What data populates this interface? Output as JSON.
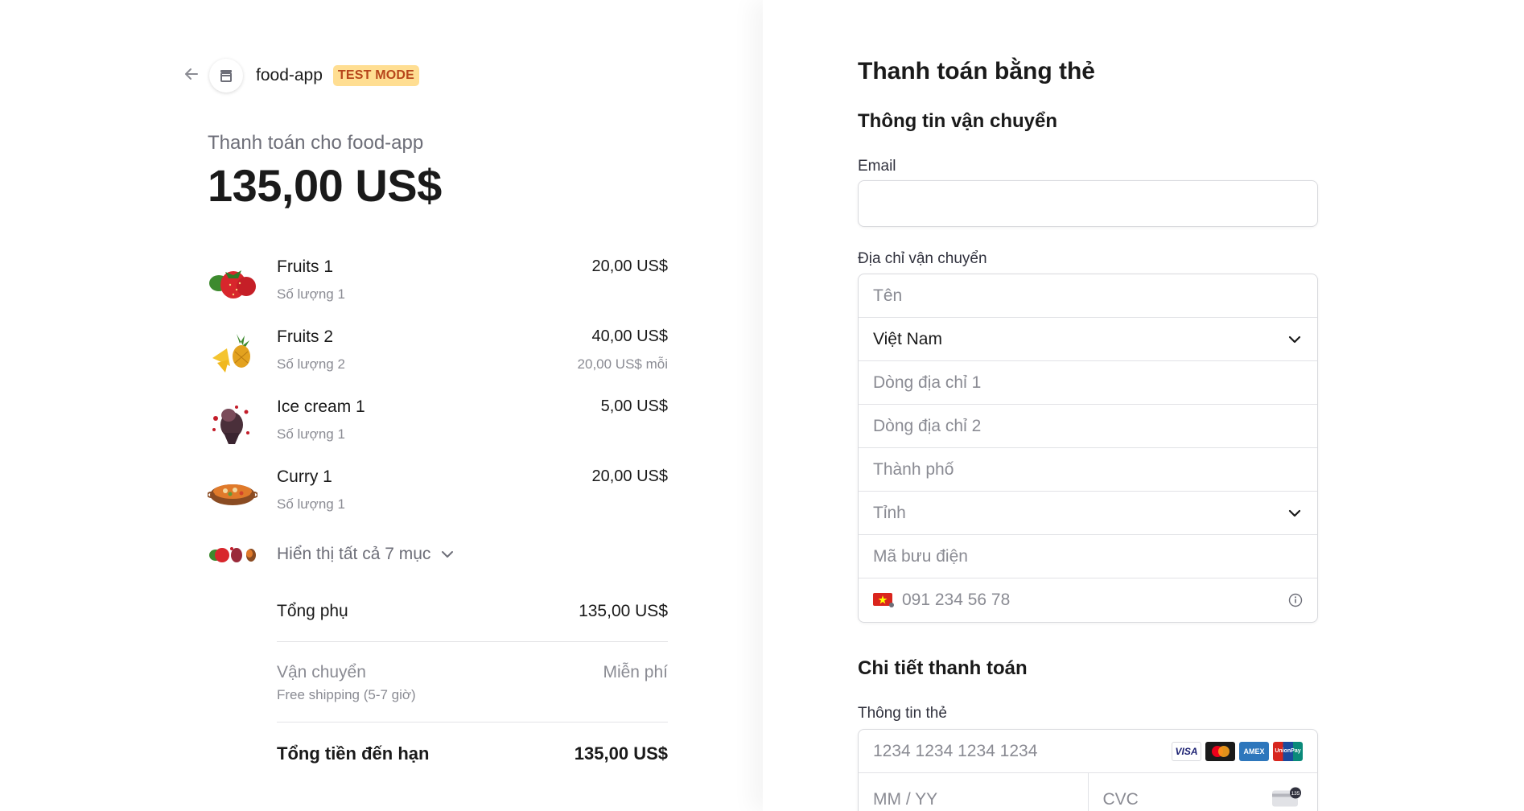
{
  "header": {
    "store_name": "food-app",
    "test_badge": "TEST MODE"
  },
  "summary": {
    "pay_for": "Thanh toán cho food-app",
    "amount": "135,00 US$"
  },
  "items": [
    {
      "name": "Fruits 1",
      "qty": "Số lượng 1",
      "price": "20,00 US$",
      "unit": "",
      "thumb": "strawberry-icon"
    },
    {
      "name": "Fruits 2",
      "qty": "Số lượng 2",
      "price": "40,00 US$",
      "unit": "20,00 US$ mỗi",
      "thumb": "pineapple-icon"
    },
    {
      "name": "Ice cream 1",
      "qty": "Số lượng 1",
      "price": "5,00 US$",
      "unit": "",
      "thumb": "ice-cream-icon"
    },
    {
      "name": "Curry 1",
      "qty": "Số lượng 1",
      "price": "20,00 US$",
      "unit": "",
      "thumb": "curry-icon"
    }
  ],
  "show_all": "Hiển thị tất cả 7 mục",
  "totals": {
    "subtotal_label": "Tổng phụ",
    "subtotal_value": "135,00 US$",
    "shipping_label": "Vận chuyển",
    "shipping_sub": "Free shipping (5-7 giờ)",
    "shipping_value": "Miễn phí",
    "total_label": "Tổng tiền đến hạn",
    "total_value": "135,00 US$"
  },
  "form": {
    "title": "Thanh toán bằng thẻ",
    "shipping_info": "Thông tin vận chuyển",
    "email_label": "Email",
    "email_value": "",
    "address_label": "Địa chỉ vận chuyển",
    "name_placeholder": "Tên",
    "country_value": "Việt Nam",
    "address1_placeholder": "Dòng địa chỉ 1",
    "address2_placeholder": "Dòng địa chỉ 2",
    "city_placeholder": "Thành phố",
    "province_placeholder": "Tỉnh",
    "postal_placeholder": "Mã bưu điện",
    "phone_placeholder": "091 234 56 78",
    "payment_details": "Chi tiết thanh toán",
    "card_info_label": "Thông tin thẻ",
    "card_number_placeholder": "1234 1234 1234 1234",
    "expiry_placeholder": "MM / YY",
    "cvc_placeholder": "CVC",
    "cvc_icon_text": "135",
    "brands": [
      "VISA",
      "mastercard",
      "AMEX",
      "UnionPay"
    ]
  },
  "colors": {
    "badge_bg": "#ffde92",
    "badge_text": "#b7461b",
    "muted_text": "#8a8b93",
    "border": "#d9dade"
  }
}
